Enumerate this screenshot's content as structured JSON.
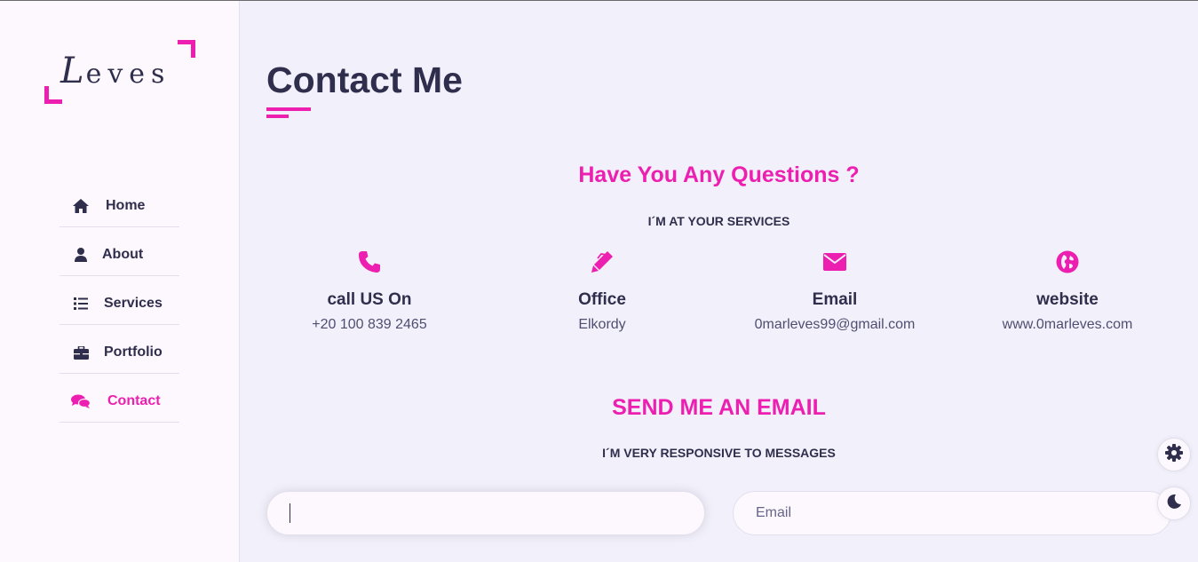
{
  "logo": {
    "first_letter": "L",
    "rest": "eves"
  },
  "nav": {
    "items": [
      {
        "label": "Home",
        "icon": "home-icon"
      },
      {
        "label": "About",
        "icon": "user-icon"
      },
      {
        "label": "Services",
        "icon": "list-icon"
      },
      {
        "label": "Portfolio",
        "icon": "briefcase-icon"
      },
      {
        "label": "Contact",
        "icon": "comments-icon",
        "active": true
      }
    ]
  },
  "page": {
    "title": "Contact Me"
  },
  "questions": {
    "title": "Have You Any Questions ?",
    "subtitle": "I´M AT YOUR SERVICES"
  },
  "contact_info": [
    {
      "icon": "phone-icon",
      "title": "call US On",
      "value": "+20 100 839 2465"
    },
    {
      "icon": "pen-icon",
      "title": "Office",
      "value": "Elkordy"
    },
    {
      "icon": "envelope-icon",
      "title": "Email",
      "value": "0marleves99@gmail.com"
    },
    {
      "icon": "globe-icon",
      "title": "website",
      "value": "www.0marleves.com"
    }
  ],
  "send_email": {
    "title": "SEND ME AN EMAIL",
    "subtitle": "I´M VERY RESPONSIVE TO MESSAGES"
  },
  "form": {
    "name_value": "",
    "email_placeholder": "Email"
  },
  "colors": {
    "accent": "#ec1fb0",
    "text": "#302e4d",
    "background": "#f2f1fb",
    "sidebar": "#fdf8fd"
  }
}
